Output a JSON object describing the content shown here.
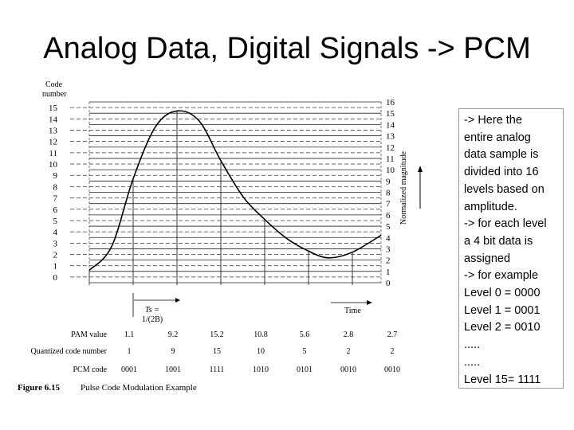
{
  "slide": {
    "title": "Analog Data, Digital Signals -> PCM",
    "notes": [
      "-> Here the",
      "entire analog",
      "data sample is",
      "divided into 16",
      "levels based on",
      "amplitude.",
      "-> for each level",
      "a 4 bit data is",
      "assigned",
      "-> for example",
      "Level 0 = 0000",
      "Level 1 = 0001",
      "Level 2 = 0010",
      ".....",
      ".....",
      "Level 15= 1111"
    ]
  },
  "figure": {
    "left_axis_label_1": "Code",
    "left_axis_label_2": "number",
    "right_axis_label": "Normalized magnitude",
    "code_numbers": [
      "0",
      "1",
      "2",
      "3",
      "4",
      "5",
      "6",
      "7",
      "8",
      "9",
      "10",
      "11",
      "12",
      "13",
      "14",
      "15"
    ],
    "magnitude_ticks": [
      "0",
      "1",
      "2",
      "3",
      "4",
      "5",
      "6",
      "7",
      "8",
      "9",
      "10",
      "11",
      "12",
      "13",
      "14",
      "15",
      "16"
    ],
    "ts_label_1": "Ts =",
    "ts_label_2": "1/(2B)",
    "time_label": "Time",
    "rows": [
      {
        "label": "PAM value",
        "values": [
          "1.1",
          "9.2",
          "15.2",
          "10.8",
          "5.6",
          "2.8",
          "2.7"
        ]
      },
      {
        "label": "Quantized code number",
        "values": [
          "1",
          "9",
          "15",
          "10",
          "5",
          "2",
          "2"
        ]
      },
      {
        "label": "PCM code",
        "values": [
          "0001",
          "1001",
          "1111",
          "1010",
          "0101",
          "0010",
          "0010"
        ]
      }
    ],
    "caption_num": "Figure 6.15",
    "caption_text": "Pulse Code Modulation Example",
    "samples": [
      1.1,
      9.2,
      15.2,
      10.8,
      5.6,
      2.8,
      2.7
    ]
  }
}
